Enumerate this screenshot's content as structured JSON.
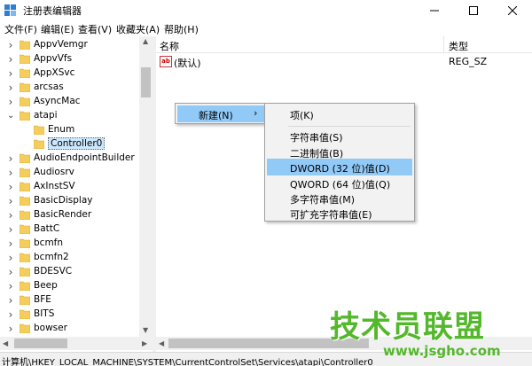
{
  "window": {
    "title": "注册表编辑器",
    "minimize_glyph": "—",
    "maximize_glyph": "☐",
    "close_glyph": "✕"
  },
  "menu": [
    "文件(F)",
    "编辑(E)",
    "查看(V)",
    "收藏夹(A)",
    "帮助(H)"
  ],
  "tree": {
    "items": [
      {
        "label": "AppvVemgr",
        "expander": ">"
      },
      {
        "label": "AppvVfs",
        "expander": ">"
      },
      {
        "label": "AppXSvc",
        "expander": ">"
      },
      {
        "label": "arcsas",
        "expander": ">"
      },
      {
        "label": "AsyncMac",
        "expander": ">"
      },
      {
        "label": "atapi",
        "expander": "v"
      },
      {
        "label": "Enum",
        "expander": ""
      },
      {
        "label": "Controller0",
        "expander": "",
        "selected": true
      },
      {
        "label": "AudioEndpointBuilder",
        "expander": ">"
      },
      {
        "label": "Audiosrv",
        "expander": ">"
      },
      {
        "label": "AxInstSV",
        "expander": ">"
      },
      {
        "label": "BasicDisplay",
        "expander": ">"
      },
      {
        "label": "BasicRender",
        "expander": ">"
      },
      {
        "label": "BattC",
        "expander": ">"
      },
      {
        "label": "bcmfn",
        "expander": ">"
      },
      {
        "label": "bcmfn2",
        "expander": ">"
      },
      {
        "label": "BDESVC",
        "expander": ">"
      },
      {
        "label": "Beep",
        "expander": ">"
      },
      {
        "label": "BFE",
        "expander": ">"
      },
      {
        "label": "BITS",
        "expander": ">"
      },
      {
        "label": "bowser",
        "expander": ">"
      }
    ]
  },
  "list": {
    "columns": {
      "name": "名称",
      "type": "类型"
    },
    "rows": [
      {
        "icon": "ab",
        "name": "(默认)",
        "type": "REG_SZ"
      }
    ]
  },
  "context_menu": {
    "parent_label": "新建(N)",
    "parent_chevron": "›",
    "submenu": [
      {
        "label": "项(K)"
      },
      {
        "label": "字符串值(S)"
      },
      {
        "label": "二进制值(B)"
      },
      {
        "label": "DWORD (32 位)值(D)",
        "highlighted": true
      },
      {
        "label": "QWORD (64 位)值(Q)"
      },
      {
        "label": "多字符串值(M)"
      },
      {
        "label": "可扩充字符串值(E)"
      }
    ]
  },
  "status": {
    "path": "计算机\\HKEY_LOCAL_MACHINE\\SYSTEM\\CurrentControlSet\\Services\\atapi\\Controller0"
  },
  "watermark": {
    "text": "技术员联盟",
    "url": "www.jsgho.com"
  },
  "colors": {
    "selection": "#cce8ff",
    "menu_highlight": "#91c9f7",
    "folder": "#f4cd5c",
    "watermark": "#53b82b"
  }
}
